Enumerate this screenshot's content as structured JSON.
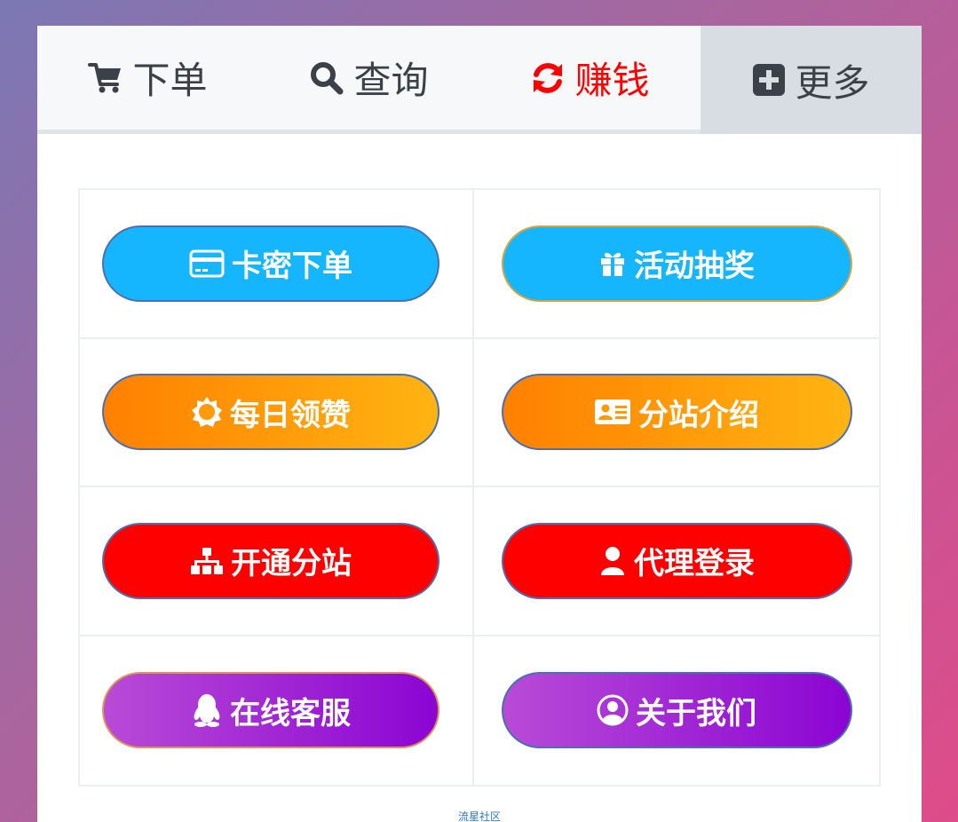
{
  "tabs": [
    {
      "label": "下单",
      "icon": "cart-icon"
    },
    {
      "label": "查询",
      "icon": "search-icon"
    },
    {
      "label": "赚钱",
      "icon": "refresh-icon",
      "color": "#ff0000"
    },
    {
      "label": "更多",
      "icon": "plus-square-icon"
    }
  ],
  "buttons": [
    {
      "label": "卡密下单",
      "icon": "credit-card-icon",
      "color": "#16b6ff"
    },
    {
      "label": "活动抽奖",
      "icon": "gift-icon",
      "color": "#16b6ff"
    },
    {
      "label": "每日领赞",
      "icon": "sun-icon",
      "color": "#ff8c00"
    },
    {
      "label": "分站介绍",
      "icon": "id-card-icon",
      "color": "#ff8c00"
    },
    {
      "label": "开通分站",
      "icon": "sitemap-icon",
      "color": "#ff0000"
    },
    {
      "label": "代理登录",
      "icon": "user-icon",
      "color": "#ff0000"
    },
    {
      "label": "在线客服",
      "icon": "qq-icon",
      "color": "#9b2ad5"
    },
    {
      "label": "关于我们",
      "icon": "user-circle-icon",
      "color": "#9b2ad5"
    }
  ],
  "footer": {
    "text": "流星社区"
  }
}
